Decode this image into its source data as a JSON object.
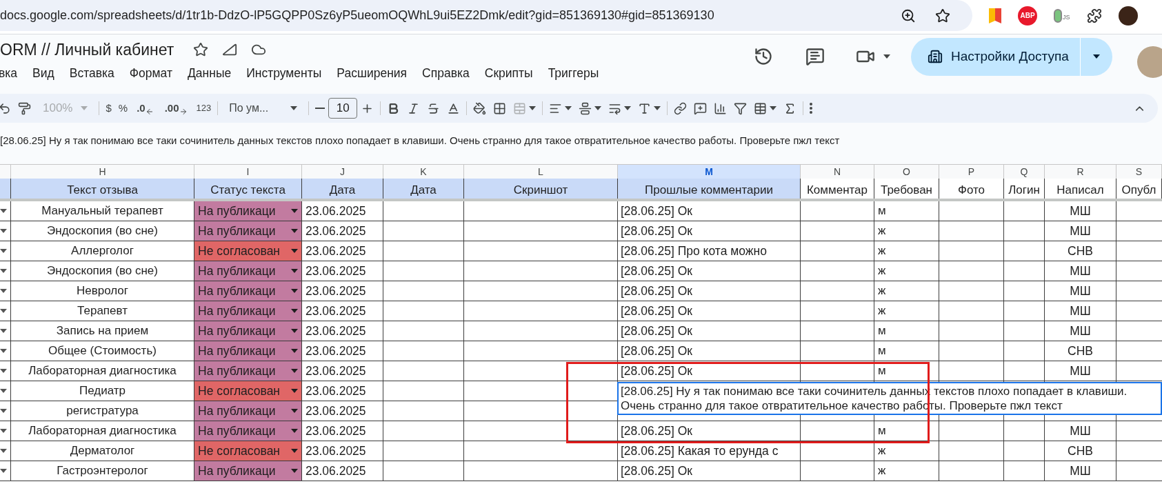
{
  "browser": {
    "url": "docs.google.com/spreadsheets/d/1tr1b-DdzO-lP5GQPP0Sz6yP5ueomOQWhL9ui5EZ2Dmk/edit?gid=851369130#gid=851369130",
    "extensions": [
      "ABP",
      "JS"
    ]
  },
  "document": {
    "title": "ORM // Личный кабинет",
    "share_button": "Настройки Доступа"
  },
  "menu": [
    "вка",
    "Вид",
    "Вставка",
    "Формат",
    "Данные",
    "Инструменты",
    "Расширения",
    "Справка",
    "Скрипты",
    "Триггеры"
  ],
  "toolbar": {
    "zoom": "100%",
    "currency": "$",
    "percent": "%",
    "decrease_decimals": ".0",
    "increase_decimals": ".00",
    "number_format": "123",
    "font": "По ум...",
    "font_size": "10"
  },
  "formula_bar": "[28.06.25] Ну я так понимаю все таки сочинитель данных текстов плохо попадает в клавиши. Очень странно для такое отвратительное качество работы. Проверьте пжл текст",
  "sheet": {
    "column_letters": [
      {
        "letter": "H",
        "selected": false
      },
      {
        "letter": "I",
        "selected": false
      },
      {
        "letter": "J",
        "selected": false
      },
      {
        "letter": "K",
        "selected": false
      },
      {
        "letter": "L",
        "selected": false
      },
      {
        "letter": "M",
        "selected": true
      },
      {
        "letter": "N",
        "selected": false
      },
      {
        "letter": "O",
        "selected": false
      },
      {
        "letter": "P",
        "selected": false
      },
      {
        "letter": "Q",
        "selected": false
      },
      {
        "letter": "R",
        "selected": false
      },
      {
        "letter": "S",
        "selected": false
      }
    ],
    "headers": [
      {
        "text": "Текст отзыва",
        "color": "#c9daf8"
      },
      {
        "text": "Статус текста",
        "color": "#c9daf8"
      },
      {
        "text": "Дата",
        "color": "#c9daf8"
      },
      {
        "text": "Дата",
        "color": "#c9daf8"
      },
      {
        "text": "Скриншот",
        "color": "#c9daf8"
      },
      {
        "text": "Прошлые комментарии",
        "color": "#c9daf8"
      },
      {
        "text": "Комментар",
        "color": "#ffffff"
      },
      {
        "text": "Требован",
        "color": "#ffffff"
      },
      {
        "text": "Фото",
        "color": "#ffffff"
      },
      {
        "text": "Логин",
        "color": "#ffffff"
      },
      {
        "text": "Написал",
        "color": "#ffffff"
      },
      {
        "text": "Опубл",
        "color": "#ffffff"
      }
    ],
    "rows": [
      {
        "review": "Мануальный терапевт",
        "status": {
          "text": "На публикаци",
          "color": "#c27ba0"
        },
        "date": "23.06.2025",
        "comment": "[28.06.25] Ок",
        "gender": "м",
        "author": "МШ"
      },
      {
        "review": "Эндоскопия (во сне)",
        "status": {
          "text": "На публикаци",
          "color": "#c27ba0"
        },
        "date": "23.06.2025",
        "comment": "[28.06.25] Ок",
        "gender": "ж",
        "author": "МШ"
      },
      {
        "review": "Аллерголог",
        "status": {
          "text": "Не согласован",
          "color": "#e06666"
        },
        "date": "23.06.2025",
        "comment": "[28.06.25] Про кота можно",
        "gender": "ж",
        "author": "СНВ"
      },
      {
        "review": "Эндоскопия (во сне)",
        "status": {
          "text": "На публикаци",
          "color": "#c27ba0"
        },
        "date": "23.06.2025",
        "comment": "[28.06.25] Ок",
        "gender": "ж",
        "author": "МШ"
      },
      {
        "review": "Невролог",
        "status": {
          "text": "На публикаци",
          "color": "#c27ba0"
        },
        "date": "23.06.2025",
        "comment": "[28.06.25] Ок",
        "gender": "ж",
        "author": "МШ"
      },
      {
        "review": "Терапевт",
        "status": {
          "text": "На публикаци",
          "color": "#c27ba0"
        },
        "date": "23.06.2025",
        "comment": "[28.06.25] Ок",
        "gender": "ж",
        "author": "МШ"
      },
      {
        "review": "Запись на прием",
        "status": {
          "text": "На публикаци",
          "color": "#c27ba0"
        },
        "date": "23.06.2025",
        "comment": "[28.06.25] Ок",
        "gender": "м",
        "author": "МШ"
      },
      {
        "review": "Общее (Стоимость)",
        "status": {
          "text": "На публикаци",
          "color": "#c27ba0"
        },
        "date": "23.06.2025",
        "comment": "[28.06.25] Ок",
        "gender": "м",
        "author": "СНВ"
      },
      {
        "review": "Лабораторная диагностика",
        "status": {
          "text": "На публикаци",
          "color": "#c27ba0"
        },
        "date": "23.06.2025",
        "comment": "[28.06.25] Ок",
        "gender": "м",
        "author": "МШ"
      },
      {
        "review": "Педиатр",
        "status": {
          "text": "Не согласован",
          "color": "#e06666"
        },
        "date": "23.06.2025"
      },
      {
        "review": "регистратура",
        "status": {
          "text": "На публикаци",
          "color": "#c27ba0"
        },
        "date": "23.06.2025"
      },
      {
        "review": "Лабораторная диагностика",
        "status": {
          "text": "На публикаци",
          "color": "#c27ba0"
        },
        "date": "23.06.2025",
        "comment": "[28.06.25] Ок",
        "gender": "м",
        "author": "МШ"
      },
      {
        "review": "Дерматолог",
        "status": {
          "text": "Не согласован",
          "color": "#e06666"
        },
        "date": "23.06.2025",
        "comment": "[28.06.25] Какая то ерунда с",
        "gender": "ж",
        "author": "СНВ"
      },
      {
        "review": "Гастроэнтеролог",
        "status": {
          "text": "На публикаци",
          "color": "#c27ba0"
        },
        "date": "23.06.2025",
        "comment": "[28.06.25] Ок",
        "gender": "ж",
        "author": "МШ"
      }
    ],
    "editor": {
      "text": "[28.06.25] Ну я так понимаю все таки сочинитель данных текстов плохо попадает в клавиши. Очень странно для такое отвратительное качество работы. Проверьте пжл текст"
    }
  }
}
